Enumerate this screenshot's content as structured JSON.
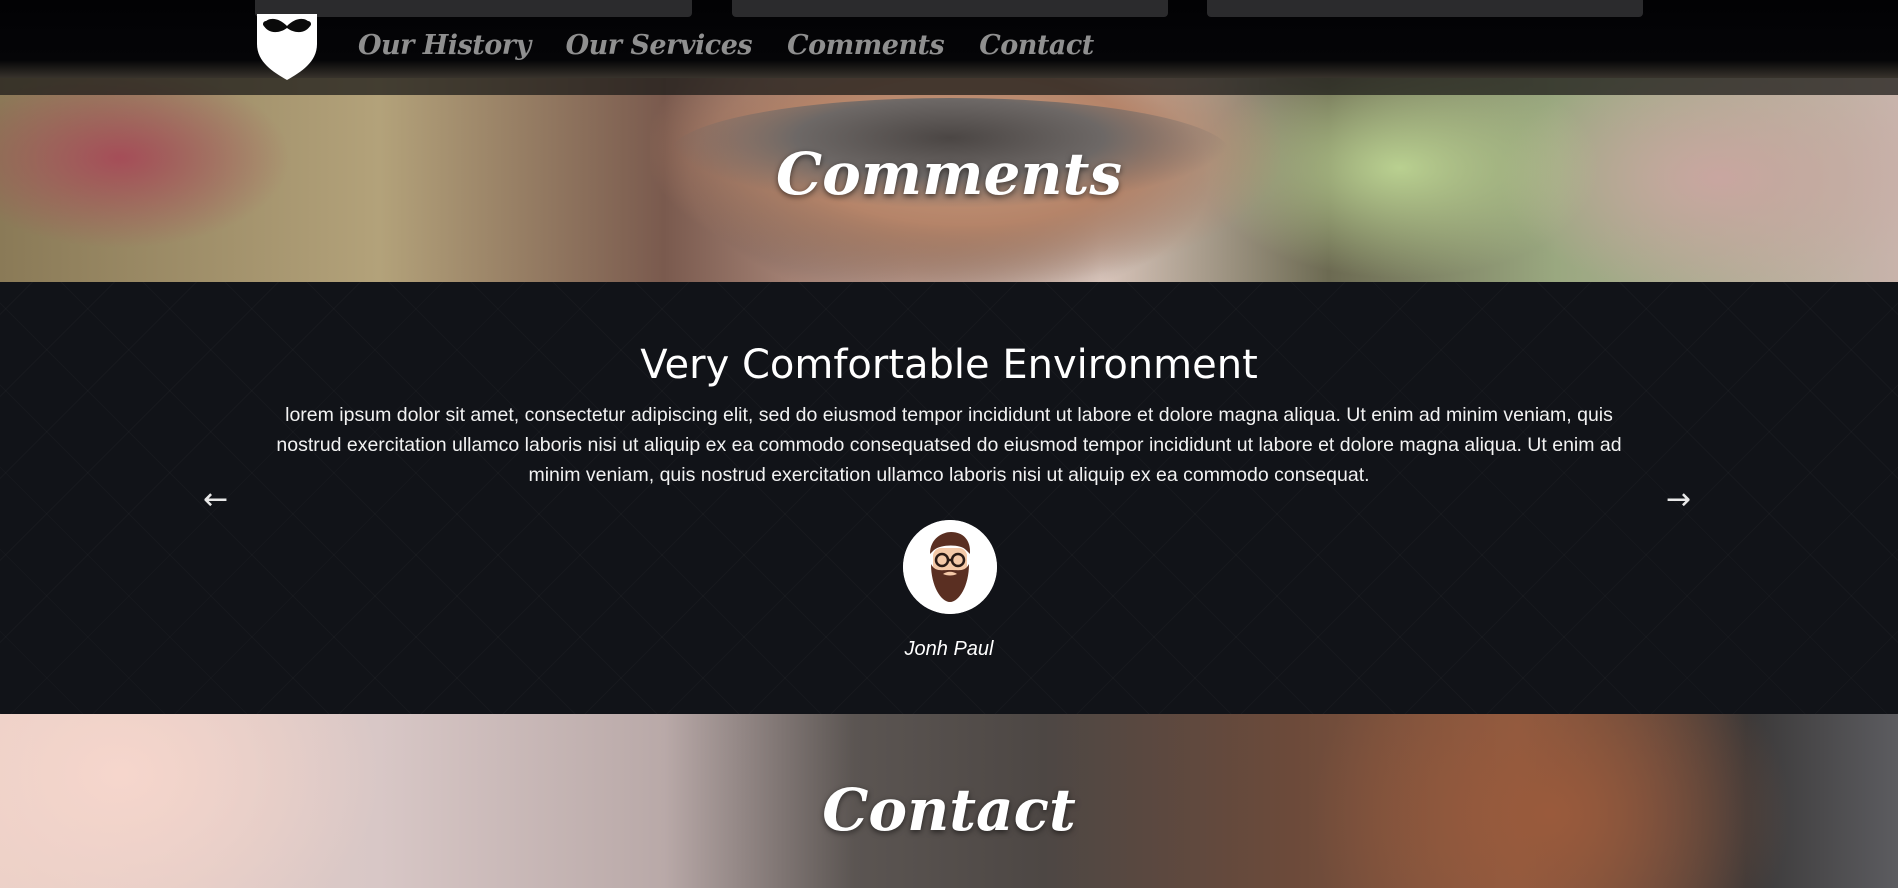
{
  "nav": {
    "items": [
      {
        "label": "Our History"
      },
      {
        "label": "Our Services"
      },
      {
        "label": "Comments"
      },
      {
        "label": "Contact"
      }
    ],
    "logo_icon": "mustache-shield-logo"
  },
  "comments_banner": {
    "title": "Comments"
  },
  "testimonial": {
    "title": "Very Comfortable Environment",
    "body": "lorem ipsum dolor sit amet, consectetur adipiscing elit, sed do eiusmod tempor incididunt ut labore et dolore magna aliqua. Ut enim ad minim veniam, quis nostrud exercitation ullamco laboris nisi ut aliquip ex ea commodo consequatsed do eiusmod tempor incididunt ut labore et dolore magna aliqua. Ut enim ad minim veniam, quis nostrud exercitation ullamco laboris nisi ut aliquip ex ea commodo consequat.",
    "prev_arrow": "←",
    "next_arrow": "→",
    "author": "Jonh Paul",
    "avatar_icon": "bearded-man-avatar"
  },
  "contact_banner": {
    "title": "Contact"
  },
  "colors": {
    "nav_text": "#8f8f8f",
    "section_bg": "#111318",
    "avatar_beard": "#5a2f22"
  }
}
